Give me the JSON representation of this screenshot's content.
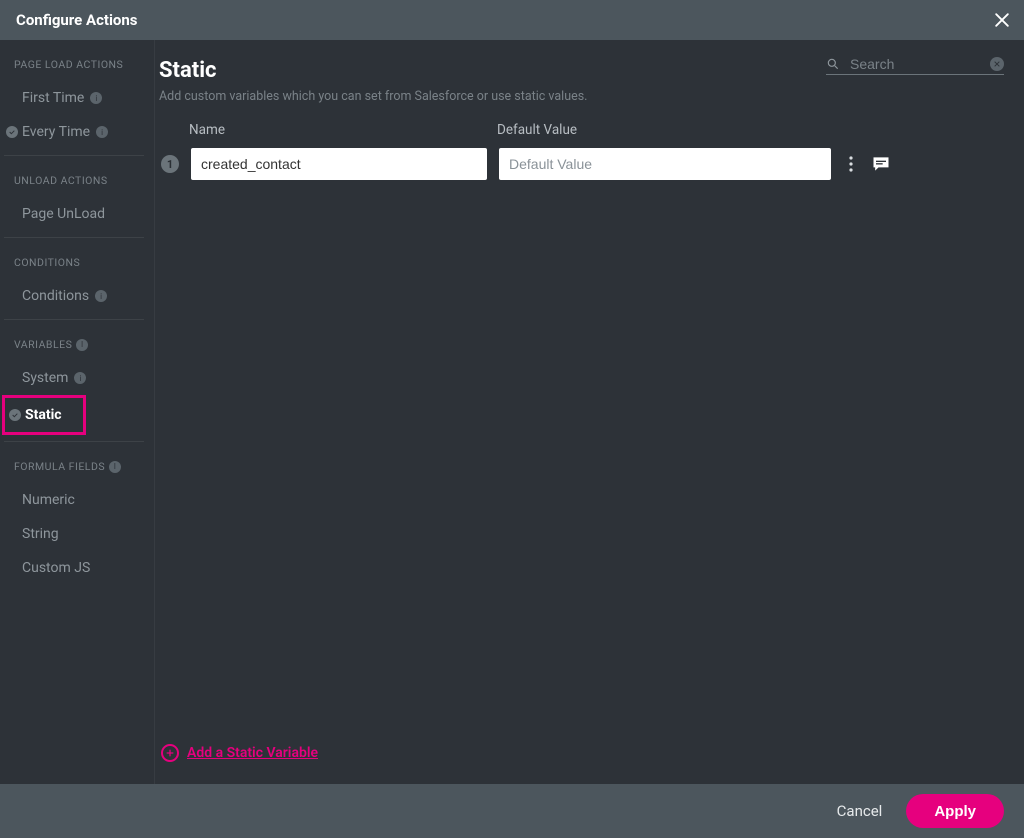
{
  "header": {
    "title": "Configure Actions"
  },
  "sidebar": {
    "sections": {
      "page_load": {
        "title": "PAGE LOAD ACTIONS",
        "items": [
          {
            "label": "First Time",
            "has_check": false
          },
          {
            "label": "Every Time",
            "has_check": true
          }
        ]
      },
      "unload": {
        "title": "UNLOAD ACTIONS",
        "items": [
          {
            "label": "Page UnLoad"
          }
        ]
      },
      "conditions": {
        "title": "CONDITIONS",
        "items": [
          {
            "label": "Conditions"
          }
        ]
      },
      "variables": {
        "title": "VARIABLES",
        "items": [
          {
            "label": "System"
          },
          {
            "label": "Static",
            "active": true,
            "has_check": true
          }
        ]
      },
      "formula": {
        "title": "FORMULA FIELDS",
        "items": [
          {
            "label": "Numeric"
          },
          {
            "label": "String"
          },
          {
            "label": "Custom JS"
          }
        ]
      }
    }
  },
  "main": {
    "title": "Static",
    "subtitle": "Add custom variables which you can set from Salesforce or use static values.",
    "search_placeholder": "Search",
    "columns": {
      "name": "Name",
      "default": "Default Value"
    },
    "row": {
      "index": "1",
      "name_value": "created_contact",
      "default_value": "",
      "default_placeholder": "Default Value"
    },
    "add_label": "Add a Static Variable"
  },
  "footer": {
    "cancel": "Cancel",
    "apply": "Apply"
  }
}
